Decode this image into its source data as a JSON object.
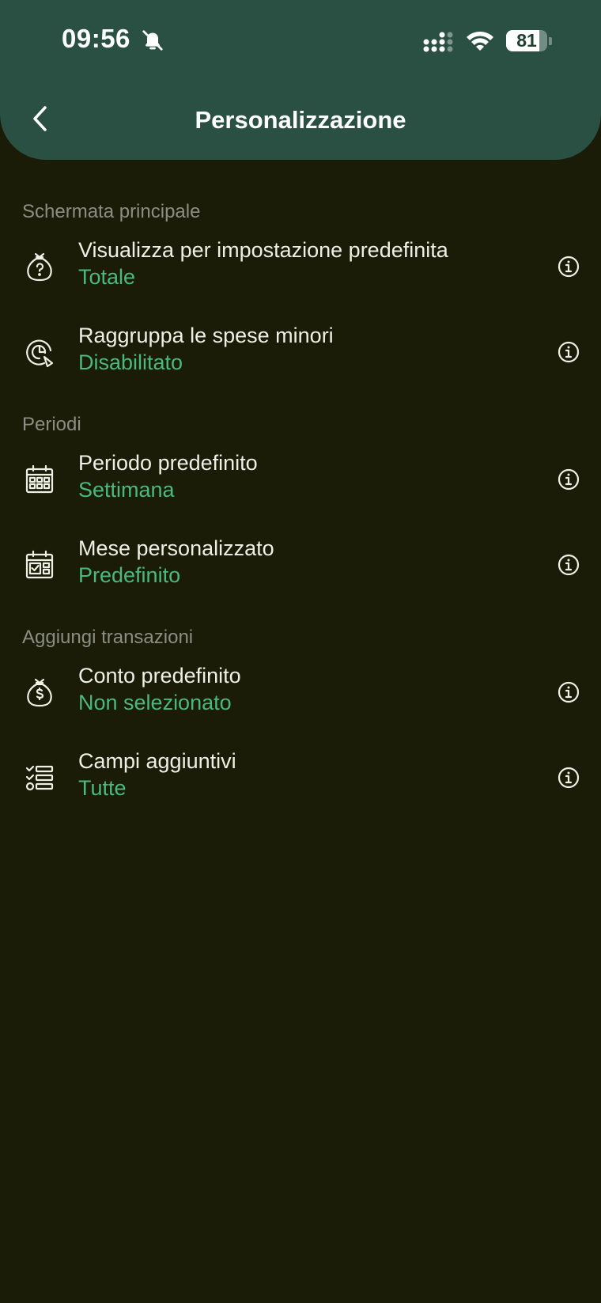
{
  "status_bar": {
    "time": "09:56",
    "battery_level": "81",
    "battery_fraction": 0.81,
    "icons": [
      "bell-off-icon",
      "signal-icon",
      "wifi-icon",
      "battery-icon"
    ]
  },
  "header": {
    "title": "Personalizzazione",
    "back_icon": "chevron-left-icon"
  },
  "colors": {
    "header_bg": "#295043",
    "page_bg": "#1a1c08",
    "accent": "#49b97e",
    "section_text": "#8b8e82"
  },
  "sections": [
    {
      "title": "Schermata principale",
      "items": [
        {
          "title": "Visualizza per impostazione predefinita",
          "value": "Totale",
          "icon": "money-bag-question-icon"
        },
        {
          "title": "Raggruppa le spese minori",
          "value": "Disabilitato",
          "icon": "pie-chart-icon"
        }
      ]
    },
    {
      "title": "Periodi",
      "items": [
        {
          "title": "Periodo predefinito",
          "value": "Settimana",
          "icon": "calendar-grid-icon"
        },
        {
          "title": "Mese personalizzato",
          "value": "Predefinito",
          "icon": "calendar-check-icon"
        }
      ]
    },
    {
      "title": "Aggiungi transazioni",
      "items": [
        {
          "title": "Conto predefinito",
          "value": "Non selezionato",
          "icon": "money-bag-dollar-icon"
        },
        {
          "title": "Campi aggiuntivi",
          "value": "Tutte",
          "icon": "checklist-icon"
        }
      ]
    }
  ]
}
